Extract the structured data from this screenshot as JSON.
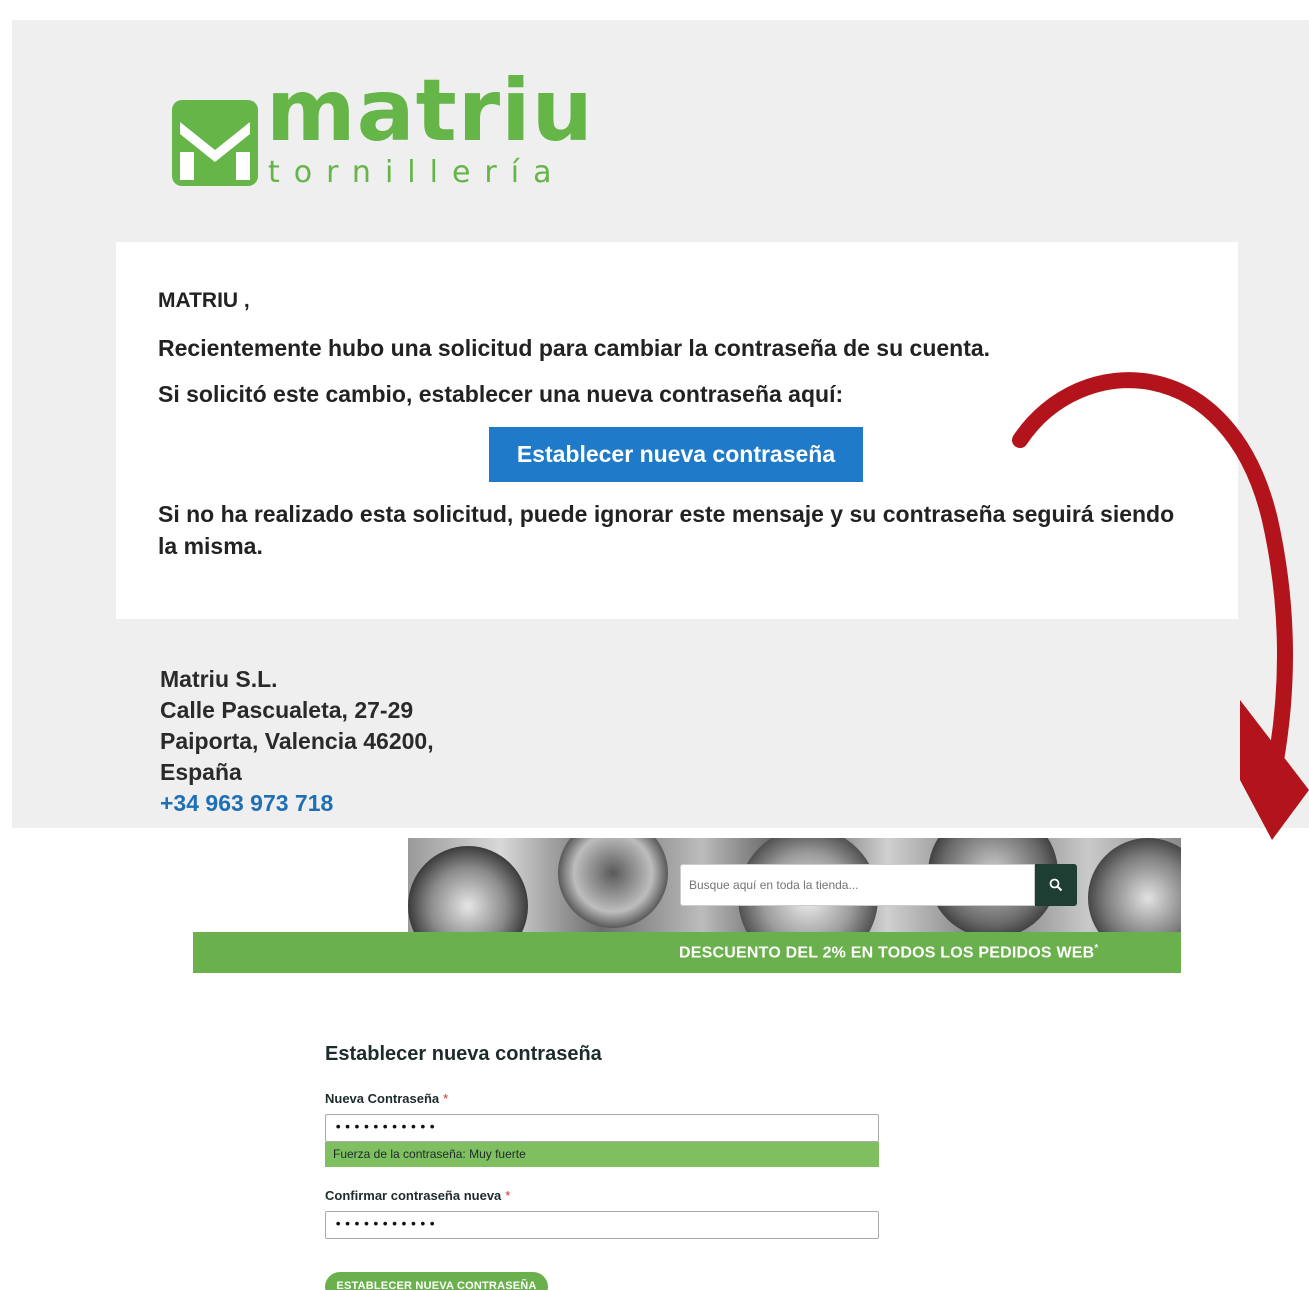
{
  "email": {
    "logo": {
      "word": "matriu",
      "subtitle": "tornillería"
    },
    "greeting": "MATRIU ,",
    "line1": "Recientemente hubo una solicitud para cambiar la contraseña de su cuenta.",
    "line2": "Si solicitó este cambio, establecer una nueva contraseña aquí:",
    "cta_label": "Establecer nueva contraseña",
    "line3": "Si no ha realizado esta solicitud, puede ignorar este mensaje y su contraseña seguirá siendo la misma.",
    "address": {
      "company": "Matriu S.L.",
      "street": "Calle Pascualeta, 27-29",
      "city": "Paiporta, Valencia 46200,",
      "country": "España",
      "phone": "+34 963 973 718"
    }
  },
  "store": {
    "search_placeholder": "Busque aquí en toda la tienda...",
    "promo_text": "DESCUENTO DEL 2% EN TODOS LOS PEDIDOS WEB",
    "promo_mark": "*",
    "form_title": "Establecer nueva contraseña",
    "new_password_label": "Nueva Contraseña",
    "required_mark": "*",
    "new_password_value": "•••••••••••",
    "strength_text": "Fuerza de la contraseña: Muy fuerte",
    "confirm_label": "Confirmar contraseña nueva",
    "confirm_value": "•••••••••••",
    "submit_label": "ESTABLECER NUEVA CONTRASEÑA"
  },
  "colors": {
    "brand_green": "#66b548",
    "promo_green": "#6ab04c",
    "cta_blue": "#1f7bc9",
    "arrow_red": "#b3141b",
    "search_button": "#1e3d33"
  },
  "icons": [
    "matriu-logo-icon",
    "search-icon",
    "curved-arrow-icon"
  ]
}
